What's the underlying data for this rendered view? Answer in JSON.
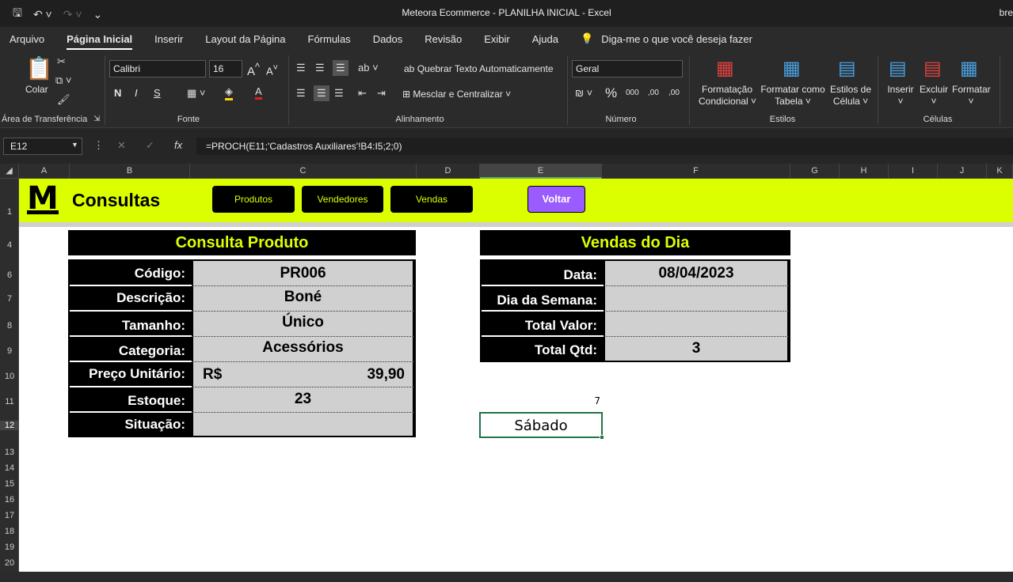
{
  "window": {
    "title": "Meteora Ecommerce - PLANILHA INICIAL  -  Excel",
    "user_fragment": "bre"
  },
  "menu": [
    "Arquivo",
    "Página Inicial",
    "Inserir",
    "Layout da Página",
    "Fórmulas",
    "Dados",
    "Revisão",
    "Exibir",
    "Ajuda"
  ],
  "tellme": "Diga-me o que você deseja fazer",
  "ribbon": {
    "paste": "Colar",
    "clipboard_group": "Área de Transferência",
    "font_name": "Calibri",
    "font_size": "16",
    "font_group": "Fonte",
    "bold": "N",
    "italic": "I",
    "underline": "S",
    "wrap": "Quebrar Texto Automaticamente",
    "merge": "Mesclar e Centralizar",
    "align_group": "Alinhamento",
    "number_format": "Geral",
    "number_group": "Número",
    "cond_format_1": "Formatação",
    "cond_format_2": "Condicional",
    "format_table_1": "Formatar como",
    "format_table_2": "Tabela",
    "cell_styles_1": "Estilos de",
    "cell_styles_2": "Célula",
    "styles_group": "Estilos",
    "insert": "Inserir",
    "delete": "Excluir",
    "format": "Formatar",
    "cells_group": "Células",
    "pct": "%",
    "thousands": "000",
    "dec_inc": ",00",
    "dec_dec": ",00"
  },
  "formula": {
    "cell_ref": "E12",
    "content": "=PROCH(E11;'Cadastros Auxiliares'!B4:I5;2;0)"
  },
  "columns": [
    "A",
    "B",
    "C",
    "D",
    "E",
    "F",
    "G",
    "H",
    "I",
    "J",
    "K"
  ],
  "rows": [
    "1",
    "4",
    "6",
    "7",
    "8",
    "9",
    "10",
    "11",
    "12",
    "13",
    "14",
    "15",
    "16",
    "17",
    "18",
    "19",
    "20"
  ],
  "banner": {
    "title": "Consultas",
    "logo": "M",
    "buttons": [
      "Produtos",
      "Vendedores",
      "Vendas"
    ],
    "voltar": "Voltar"
  },
  "produto": {
    "title": "Consulta Produto",
    "rows": [
      {
        "label": "Código:",
        "value": "PR006"
      },
      {
        "label": "Descrição:",
        "value": "Boné"
      },
      {
        "label": "Tamanho:",
        "value": "Único"
      },
      {
        "label": "Categoria:",
        "value": "Acessórios"
      },
      {
        "label": "Preço Unitário:",
        "currency": "R$",
        "value": "39,90"
      },
      {
        "label": "Estoque:",
        "value": "23"
      },
      {
        "label": "Situação:",
        "value": ""
      }
    ]
  },
  "vendas": {
    "title": "Vendas do Dia",
    "rows": [
      {
        "label": "Data:",
        "value": "08/04/2023"
      },
      {
        "label": "Dia da Semana:",
        "value": ""
      },
      {
        "label": "Total Valor:",
        "value": ""
      },
      {
        "label": "Total Qtd:",
        "value": "3"
      }
    ]
  },
  "cells": {
    "e11": "7",
    "e12": "Sábado"
  }
}
